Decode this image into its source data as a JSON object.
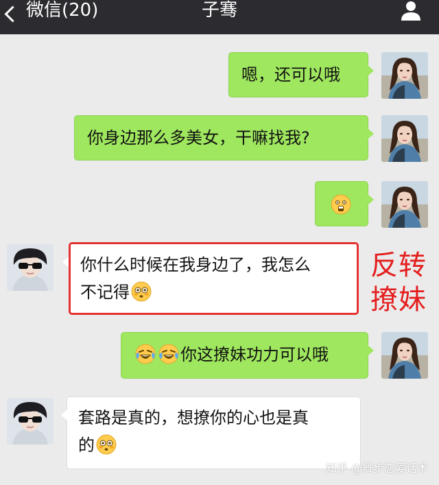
{
  "header": {
    "back_label": "微信(20)",
    "title": "子骞"
  },
  "messages": [
    {
      "side": "right",
      "text": "嗯，还可以哦"
    },
    {
      "side": "right",
      "text": "你身边那么多美女，干嘛找我?"
    },
    {
      "side": "right",
      "text": "",
      "emoji": "astonished-emoji"
    },
    {
      "side": "left",
      "line1": "你什么时候在我身边了，我怎么",
      "line2": "不记得",
      "emoji": "flushed-emoji"
    },
    {
      "side": "right",
      "text": "你这撩妹功力可以哦",
      "emoji": "crying-laughing-emoji"
    },
    {
      "side": "left",
      "line1": "套路是真的，想撩你的心也是真",
      "line2": "的",
      "emoji": "flushed-emoji"
    }
  ],
  "annotation": {
    "line1": "反转",
    "line2": "撩妹"
  },
  "watermark": "知乎 @舞步恋爱话术",
  "colors": {
    "topbar": "#2b2b30",
    "background": "#ebebeb",
    "outgoing_bubble": "#9fe75f",
    "incoming_bubble": "#ffffff",
    "highlight": "#e53030"
  },
  "icons": {
    "back": "chevron-left-icon",
    "profile": "user-icon"
  }
}
